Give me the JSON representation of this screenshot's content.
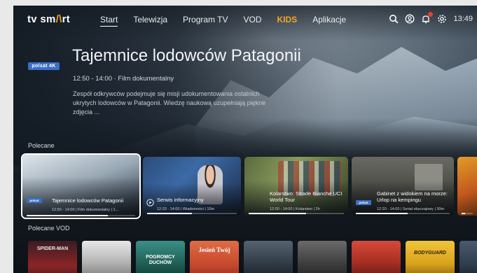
{
  "nav": {
    "logo_prefix": "tv sm",
    "logo_mark": "/\\",
    "logo_suffix": "rt",
    "items": [
      {
        "label": "Start",
        "active": true
      },
      {
        "label": "Telewizja"
      },
      {
        "label": "Program TV"
      },
      {
        "label": "VOD"
      },
      {
        "label": "KIDS",
        "accent": "#f5a623"
      },
      {
        "label": "Aplikacje"
      }
    ],
    "icons": [
      "search-icon",
      "profile-icon",
      "notification-icon",
      "settings-icon"
    ],
    "time": "13:49"
  },
  "hero": {
    "channel_logo": "polsat 4K",
    "title": "Tajemnice lodowców Patagonii",
    "meta": "12:50 - 14:00  ·  Film dokumentalny",
    "description": "Zespół odkrywców podejmuje się misji udokumentowania ostatnich ukrytych lodowców w Patagonii. Wiedzę naukową uzupełniają piękne zdjęcia ..."
  },
  "recommended": {
    "label": "Polecane",
    "cards": [
      {
        "title": "Tajemnice lodowców Patagonii",
        "subtitle": "12:50 - 14:00 | Film dokumentalny | 1...",
        "progress": 0.75,
        "focused": true
      },
      {
        "title": "Serwis informacyjny",
        "subtitle": "12:20 - 14:00 | Wiadomości | 10m",
        "progress": 0.5
      },
      {
        "title": "Kolarstwo: Strade Bianche UCI World Tour",
        "subtitle": "12:00 - 14:00 | Kolarstwo | 2h",
        "progress": 0.6
      },
      {
        "title": "Gabinet z widokiem na morze: Urlop na kempingu",
        "subtitle": "12:20 - 14:00 | Serial obyczajowy | 30m",
        "progress": 0.55
      },
      {
        "title": "",
        "subtitle": "",
        "progress": 0.3
      }
    ]
  },
  "vod": {
    "label": "Polecane VOD",
    "posters": [
      {
        "title": "SPIDER-MAN",
        "color": "#5a2a2a"
      },
      {
        "title": "",
        "color": "#b8b8b8"
      },
      {
        "title": "POGROMCY DUCHÓW",
        "color": "#1f5f56"
      },
      {
        "title": "Jesień Twój",
        "color": "#d2593a"
      },
      {
        "title": "",
        "color": "#2f3a45"
      },
      {
        "title": "",
        "color": "#4a4a4a"
      },
      {
        "title": "",
        "color": "#c0392b"
      },
      {
        "title": "BODYGUARD",
        "color": "#e0b52a"
      },
      {
        "title": "",
        "color": "#2d3b4a"
      }
    ]
  }
}
